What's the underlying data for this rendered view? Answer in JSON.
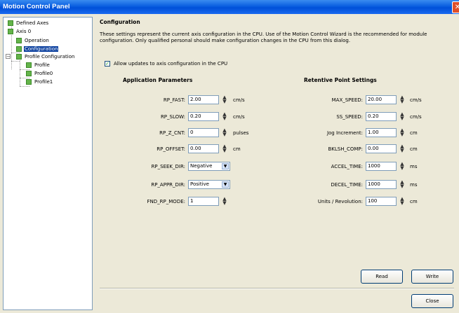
{
  "window": {
    "title": "Motion Control Panel",
    "close_glyph": "✕"
  },
  "tree": {
    "items": [
      {
        "label": "Defined Axes",
        "icon": "axis-icon"
      },
      {
        "label": "Axis 0",
        "icon": "axis-icon"
      },
      {
        "label": "Operation",
        "icon": "operation-icon"
      },
      {
        "label": "Configuration",
        "icon": "configuration-icon",
        "selected": true
      },
      {
        "label": "Profile Configuration",
        "icon": "profile-icon",
        "toggle": "−"
      },
      {
        "label": "Profile",
        "icon": "profile-icon"
      },
      {
        "label": "Profile0",
        "icon": "profile-icon"
      },
      {
        "label": "Profile1",
        "icon": "profile-icon"
      }
    ]
  },
  "config": {
    "title": "Configuration",
    "description": "These settings represent the current axis configuration in the CPU. Use of the Motion Control Wizard is the recommended for module configuration.  Only qualified personal should make configuration changes in the CPU from this dialog.",
    "allow_updates": {
      "label": "Allow updates to axis configuration in the CPU",
      "checked": true,
      "check_glyph": "✓"
    },
    "app_params": {
      "title": "Application Parameters",
      "rows": [
        {
          "label": "RP_FAST:",
          "value": "2.00",
          "unit": "cm/s",
          "kind": "spin"
        },
        {
          "label": "RP_SLOW:",
          "value": "0.20",
          "unit": "cm/s",
          "kind": "spin"
        },
        {
          "label": "RP_Z_CNT:",
          "value": "0",
          "unit": "pulses",
          "kind": "spin"
        },
        {
          "label": "RP_OFFSET:",
          "value": "0.00",
          "unit": "cm",
          "kind": "spin"
        },
        {
          "label": "RP_SEEK_DIR:",
          "value": "Negative",
          "kind": "select"
        },
        {
          "label": "RP_APPR_DIR:",
          "value": "Positive",
          "kind": "select"
        },
        {
          "label": "FND_RP_MODE:",
          "value": "1",
          "kind": "spin"
        }
      ]
    },
    "retentive": {
      "title": "Retentive Point Settings",
      "rows": [
        {
          "label": "MAX_SPEED:",
          "value": "20.00",
          "unit": "cm/s"
        },
        {
          "label": "SS_SPEED:",
          "value": "0.20",
          "unit": "cm/s"
        },
        {
          "label": "Jog Increment:",
          "value": "1.00",
          "unit": "cm"
        },
        {
          "label": "BKLSH_COMP:",
          "value": "0.00",
          "unit": "cm"
        },
        {
          "label": "ACCEL_TIME:",
          "value": "1000",
          "unit": "ms"
        },
        {
          "label": "DECEL_TIME:",
          "value": "1000",
          "unit": "ms"
        },
        {
          "label": "Units / Revolution:",
          "value": "100",
          "unit": "cm"
        }
      ]
    },
    "spin_up": "▲",
    "spin_down": "▼",
    "select_arrow": "▼"
  },
  "buttons": {
    "read": "Read",
    "write": "Write",
    "close": "Close"
  }
}
